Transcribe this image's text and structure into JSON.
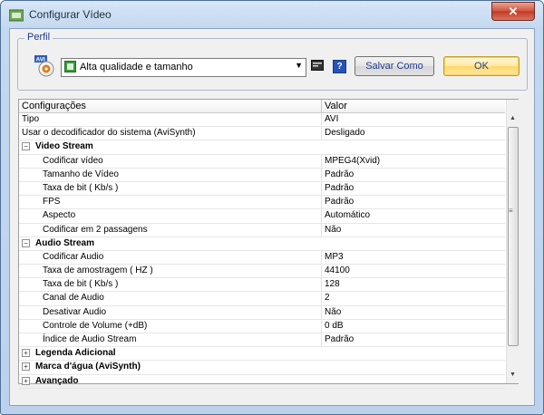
{
  "window": {
    "title": "Configurar Vídeo",
    "close_label": "✕"
  },
  "profile": {
    "group_label": "Perfil",
    "selected": "Alta qualidade e tamanho",
    "save_as_label": "Salvar Como",
    "ok_label": "OK",
    "avi_badge": "AVI"
  },
  "grid": {
    "col_name": "Configurações",
    "col_value": "Valor",
    "rows": [
      {
        "kind": "top",
        "name": "Tipo",
        "value": "AVI"
      },
      {
        "kind": "top",
        "name": "Usar o decodificador do sistema (AviSynth)",
        "value": "Desligado"
      },
      {
        "kind": "cat",
        "name": "Video Stream",
        "expander": "−"
      },
      {
        "kind": "child",
        "name": "Codificar vídeo",
        "value": "MPEG4(Xvid)"
      },
      {
        "kind": "child",
        "name": "Tamanho de Vídeo",
        "value": "Padrão"
      },
      {
        "kind": "child",
        "name": "Taxa de bit ( Kb/s )",
        "value": "Padrão"
      },
      {
        "kind": "child",
        "name": "FPS",
        "value": "Padrão"
      },
      {
        "kind": "child",
        "name": "Aspecto",
        "value": "Automático"
      },
      {
        "kind": "child",
        "name": "Codificar em 2 passagens",
        "value": "Não"
      },
      {
        "kind": "cat",
        "name": "Audio Stream",
        "expander": "−"
      },
      {
        "kind": "child",
        "name": "Codificar Audio",
        "value": "MP3"
      },
      {
        "kind": "child",
        "name": "Taxa de amostragem ( HZ )",
        "value": "44100"
      },
      {
        "kind": "child",
        "name": "Taxa de bit ( Kb/s )",
        "value": "128"
      },
      {
        "kind": "child",
        "name": "Canal de Audio",
        "value": "2"
      },
      {
        "kind": "child",
        "name": "Desativar Audio",
        "value": "Não"
      },
      {
        "kind": "child",
        "name": "Controle de Volume (+dB)",
        "value": "0 dB"
      },
      {
        "kind": "child",
        "name": "Índice de Audio Stream",
        "value": "Padrão"
      },
      {
        "kind": "cat",
        "name": "Legenda Adicional",
        "expander": "+"
      },
      {
        "kind": "cat",
        "name": "Marca d'água (AviSynth)",
        "expander": "+"
      },
      {
        "kind": "cat",
        "name": "Avançado",
        "expander": "+"
      }
    ]
  },
  "colors": {
    "accent": "#1e3b8f",
    "close": "#c03a24",
    "ok_highlight": "#ffd86c"
  }
}
